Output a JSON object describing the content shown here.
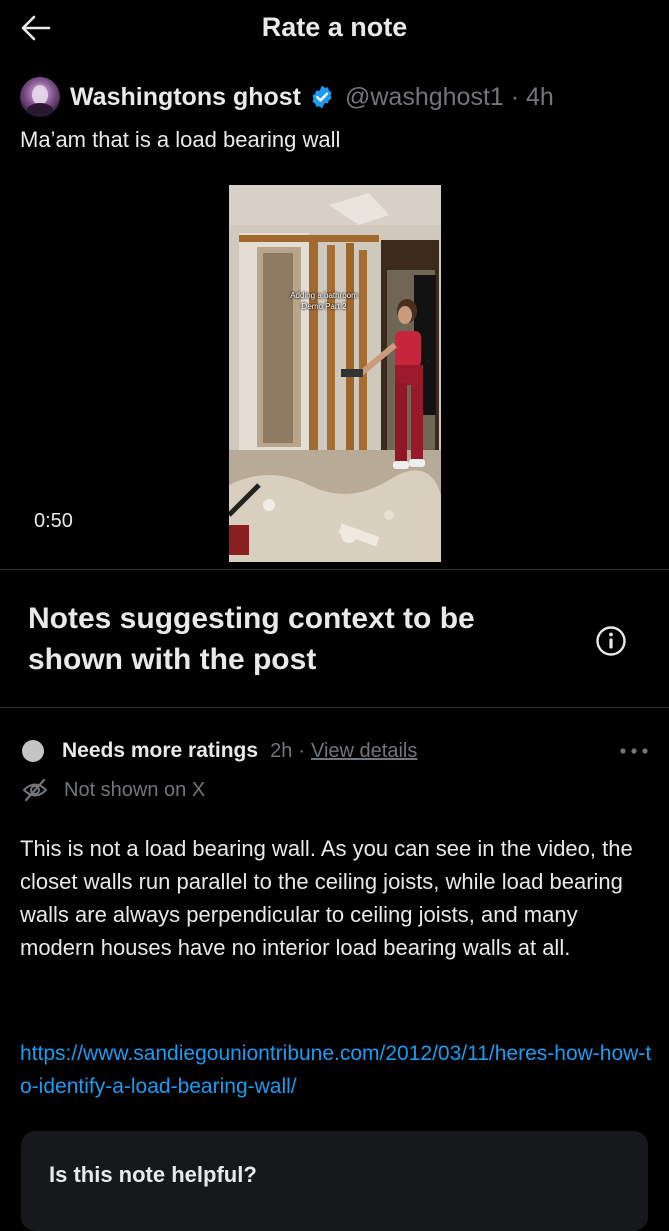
{
  "header": {
    "title": "Rate a note",
    "back_icon": "arrow-left-icon"
  },
  "post": {
    "author_name": "Washingtons ghost",
    "verified_icon": "verified-badge-icon",
    "handle": "@washghost1 · 4h",
    "text": "Ma’am that is a load bearing wall",
    "video": {
      "duration": "0:50",
      "caption_line1": "Adding a bathroom",
      "caption_line2": "Demo Part 2"
    }
  },
  "notes_section": {
    "title": "Notes suggesting context to be shown with the post",
    "info_icon": "info-icon"
  },
  "note": {
    "status_label": "Needs more ratings",
    "time": "2h",
    "separator": "·",
    "view_details": "View details",
    "not_shown": "Not shown on X",
    "body": "This is not a load bearing wall. As you can see in the video, the closet walls run parallel to the ceiling joists, while load bearing walls are always perpendicular to ceiling joists, and many modern houses have no interior load bearing walls at all.",
    "link": "https://www.sandiegouniontribune.com/2012/03/11/heres-how-how-to-identify-a-load-bearing-wall/"
  },
  "helpful_card": {
    "title": "Is this note helpful?"
  },
  "colors": {
    "background": "#000000",
    "text": "#e7e9ea",
    "secondary": "#71767b",
    "link": "#1d9bf0",
    "verified": "#1d9bf0",
    "divider": "#2f3336",
    "card": "#16181c"
  }
}
